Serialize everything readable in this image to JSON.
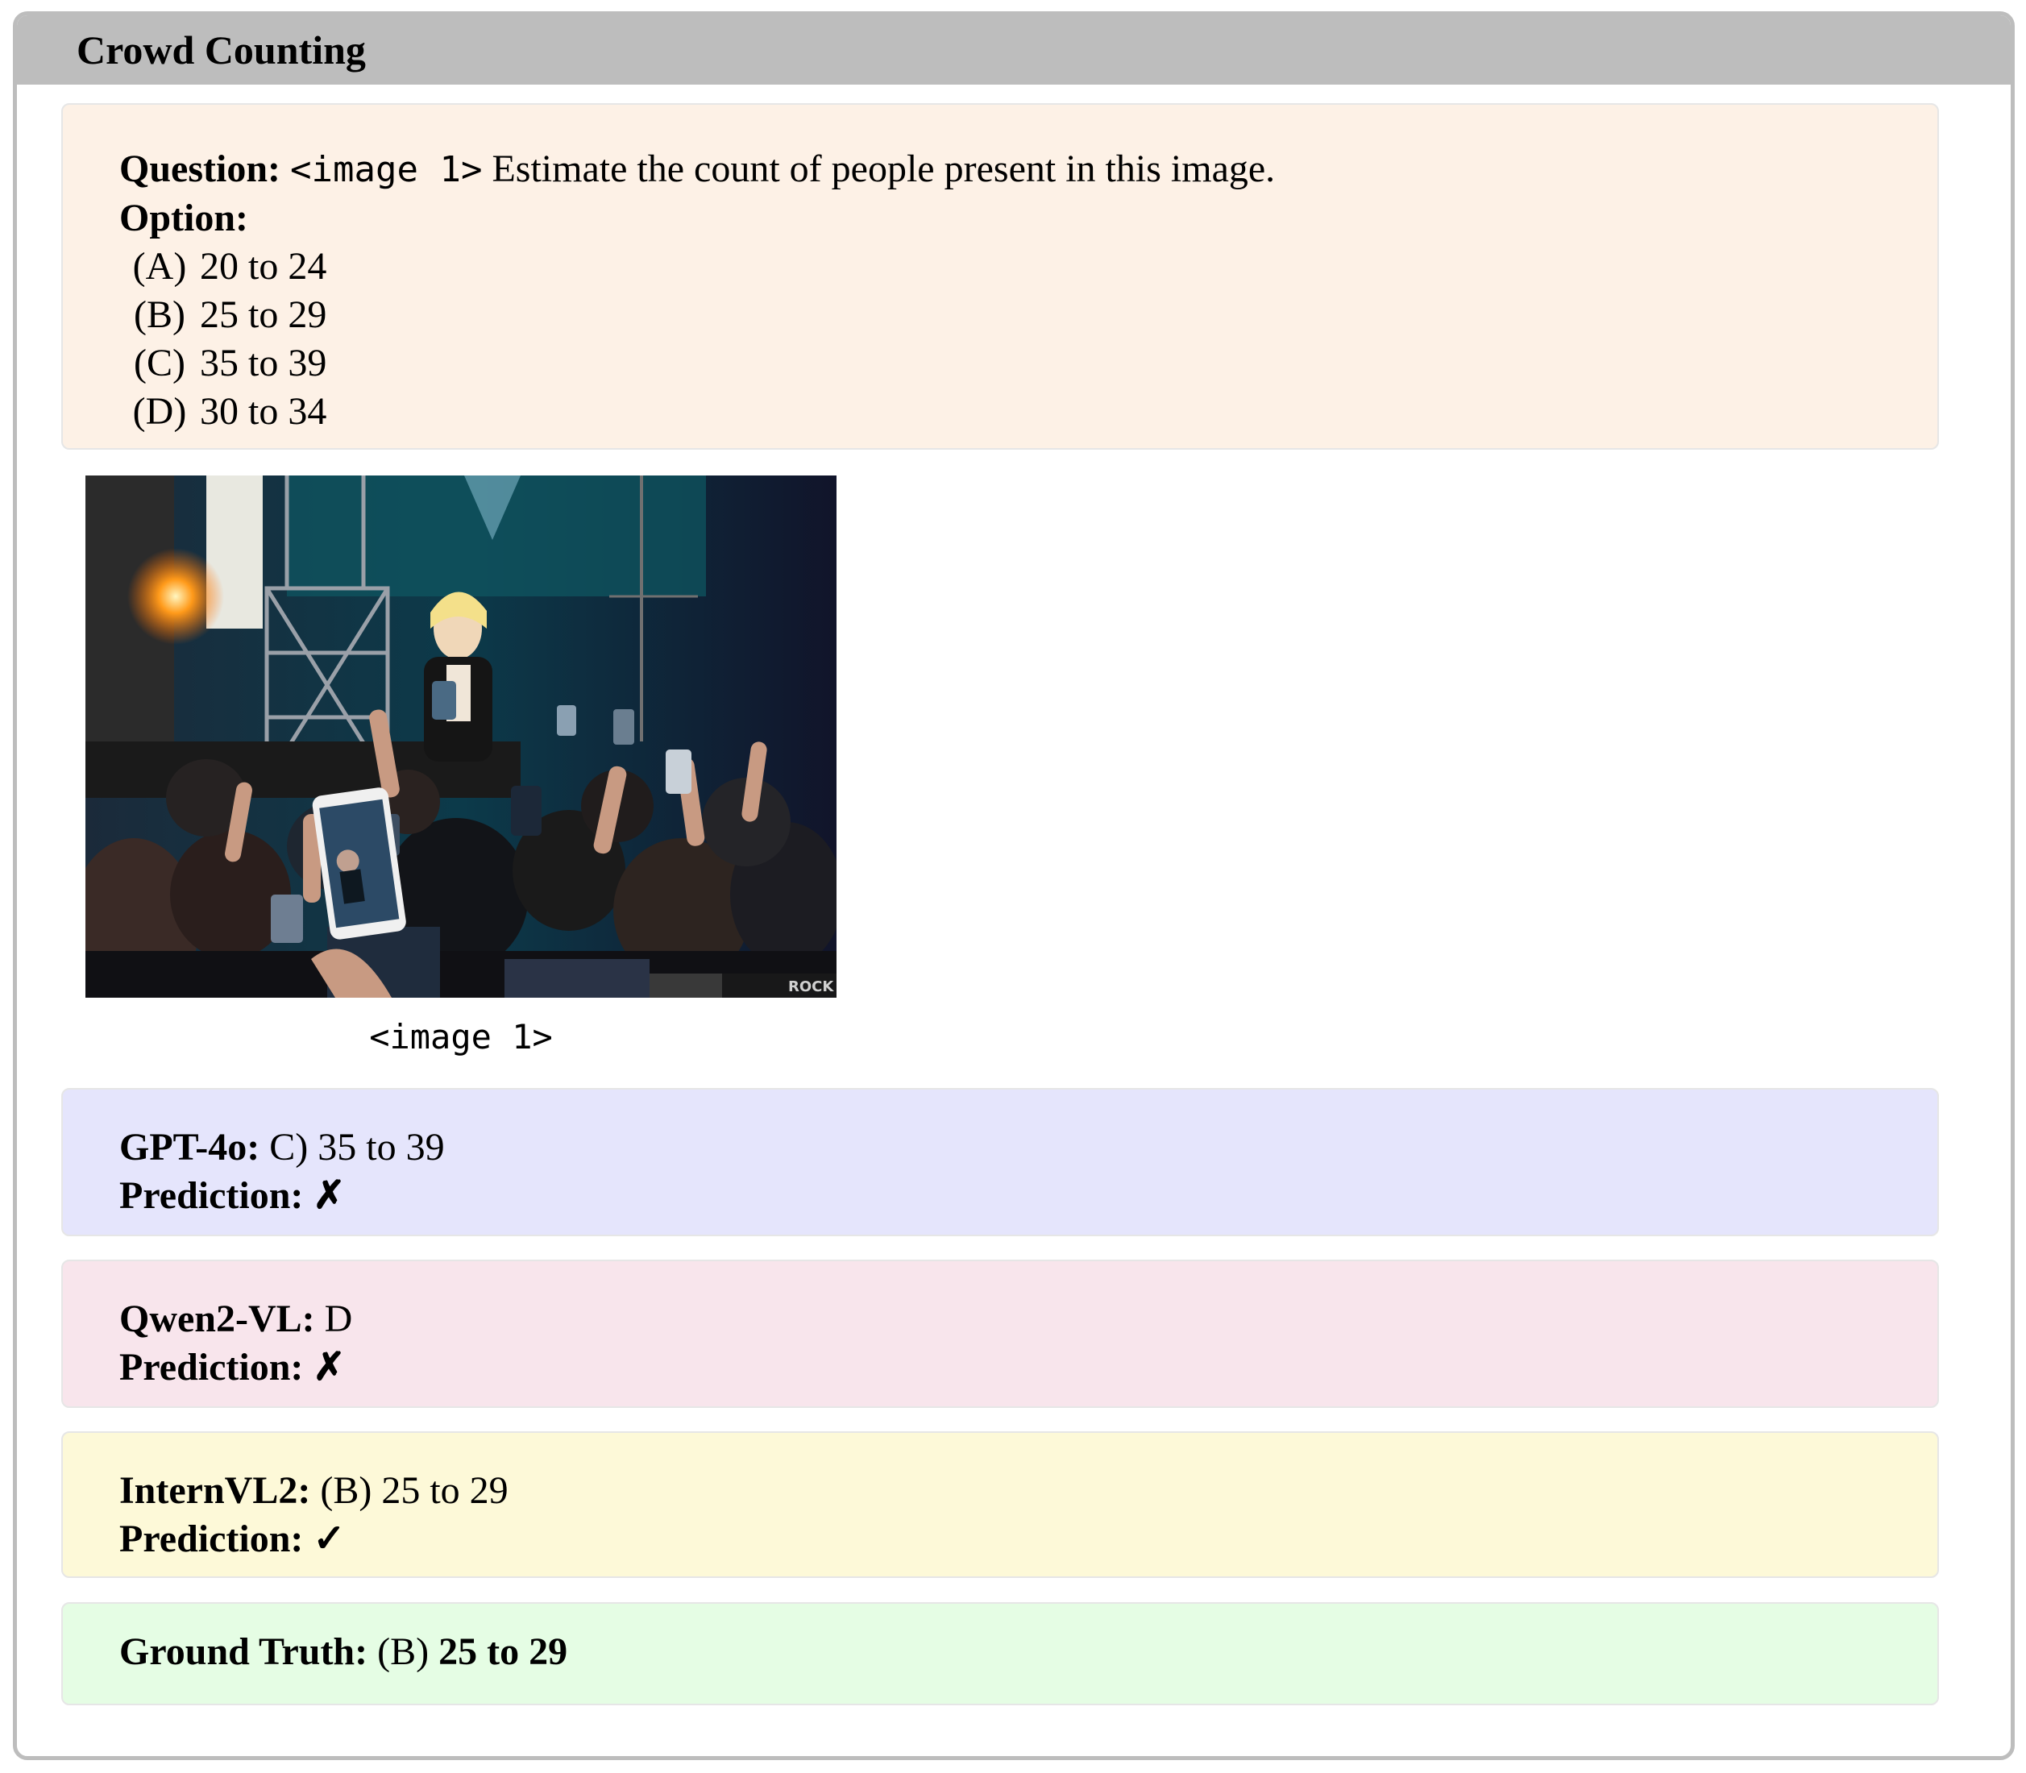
{
  "header": {
    "title": "Crowd Counting"
  },
  "question": {
    "label": "Question:",
    "image_tag": "<image 1>",
    "text": "Estimate the count of people present in this image.",
    "option_label": "Option:",
    "options": [
      {
        "letter": "(A)",
        "text": "20 to 24"
      },
      {
        "letter": "(B)",
        "text": "25 to 29"
      },
      {
        "letter": "(C)",
        "text": "35 to 39"
      },
      {
        "letter": "(D)",
        "text": "30 to 34"
      }
    ]
  },
  "figure": {
    "caption": "<image 1>",
    "watermark": "ROCK"
  },
  "models": [
    {
      "name": "GPT-4o:",
      "answer": "C) 35 to 39",
      "prediction_label": "Prediction:",
      "mark": "✗"
    },
    {
      "name": "Qwen2-VL:",
      "answer": "D",
      "prediction_label": "Prediction:",
      "mark": "✗"
    },
    {
      "name": "InternVL2:",
      "answer": "(B) 25 to 29",
      "prediction_label": "Prediction:",
      "mark": "✓"
    }
  ],
  "ground_truth": {
    "label": "Ground Truth:",
    "letter": "(B)",
    "answer": "25 to 29"
  },
  "colors": {
    "header": "#bdbdbd",
    "question_bg": "#fdf1e6",
    "gpt_bg": "#e5e5fc",
    "qwen_bg": "#f8e5ec",
    "intern_bg": "#fdf9d8",
    "truth_bg": "#e5fde4"
  }
}
